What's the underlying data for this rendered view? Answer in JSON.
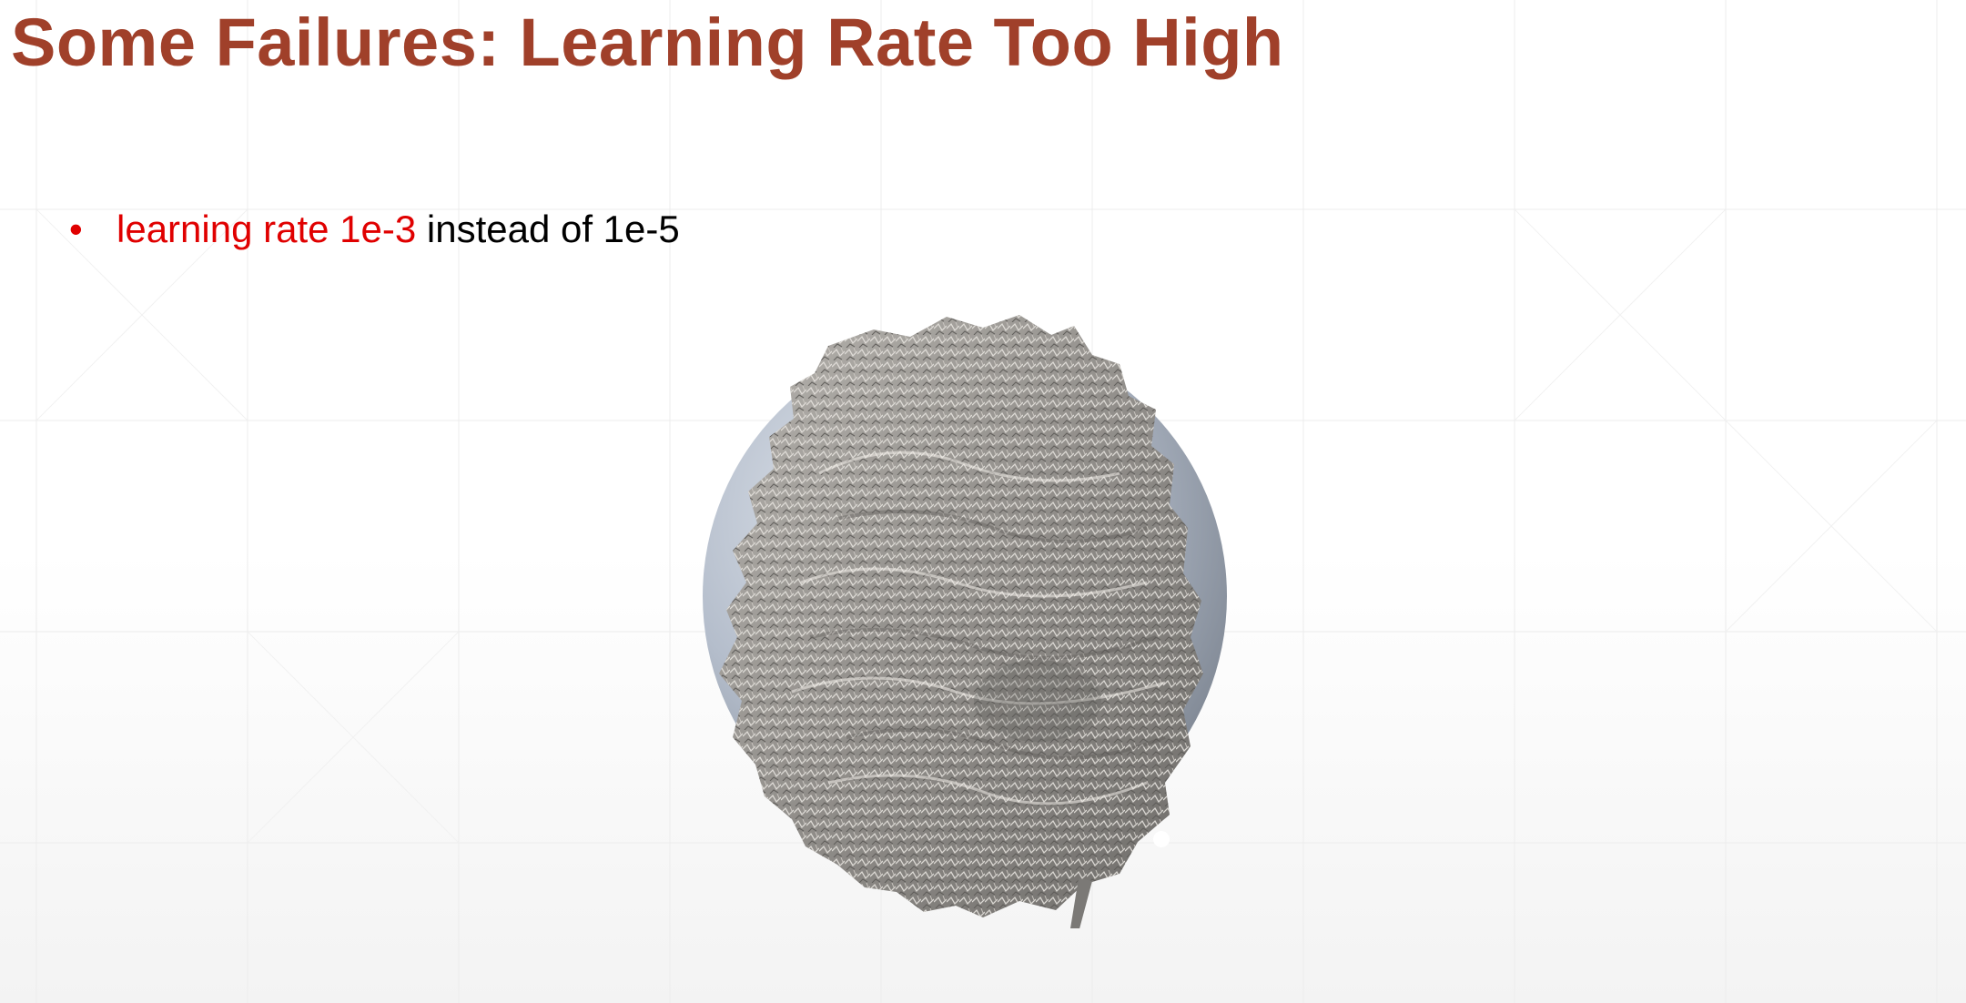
{
  "slide": {
    "title": "Some Failures: Learning Rate Too High",
    "bullets": [
      {
        "marker": "•",
        "highlight": "learning rate 1e-3",
        "rest": " instead of 1e-5"
      }
    ]
  },
  "colors": {
    "title": "#a0402a",
    "highlight": "#e00000",
    "grid": "#ececec",
    "sphere": "#aab4c4",
    "mesh": "#8e8c8a"
  }
}
